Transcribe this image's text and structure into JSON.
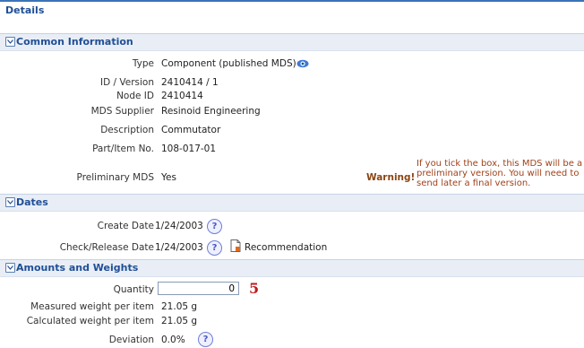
{
  "panel": {
    "title": "Details"
  },
  "common": {
    "header": "Common Information",
    "rows": [
      {
        "label": "Type",
        "value": "Component (published MDS)"
      },
      {
        "label": "ID / Version",
        "value": "2410414 / 1"
      },
      {
        "label": "Node ID",
        "value": "2410414"
      },
      {
        "label": "MDS Supplier",
        "value": "Resinoid Engineering"
      },
      {
        "label": "Description",
        "value": "Commutator"
      },
      {
        "label": "Part/Item No.",
        "value": "108-017-01"
      },
      {
        "label": "Preliminary MDS",
        "value": "Yes"
      }
    ],
    "warning_label": "Warning!",
    "warning_lines": [
      "If you tick the box, this MDS will be a",
      "preliminary version. You will need to",
      "send later a final version."
    ]
  },
  "dates": {
    "header": "Dates",
    "create_label": "Create Date",
    "create_value": "1/24/2003",
    "release_label": "Check/Release Date",
    "release_value": "1/24/2003",
    "recommendation": "Recommendation"
  },
  "amounts": {
    "header": "Amounts and Weights",
    "quantity_label": "Quantity",
    "quantity_value": "0",
    "annotation": "5",
    "measured_label": "Measured weight per item",
    "measured_value": "21.05  g",
    "calculated_label": "Calculated weight per item",
    "calculated_value": "21.05  g",
    "deviation_label": "Deviation",
    "deviation_value": "0.0%"
  },
  "icons": {
    "help_glyph": "?",
    "toggle": "chevron-down-icon"
  }
}
